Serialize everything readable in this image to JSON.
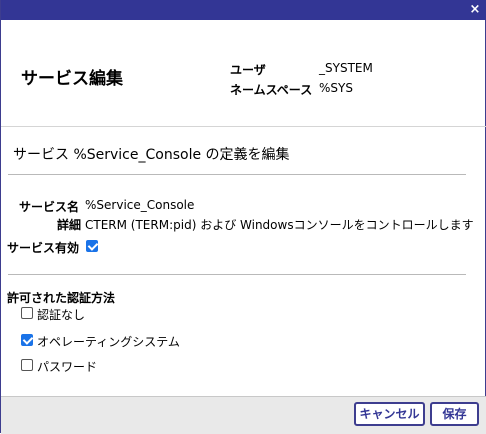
{
  "window": {
    "close_icon": "×"
  },
  "header": {
    "title": "サービス編集",
    "user_label": "ユーザ",
    "user_value": "_SYSTEM",
    "namespace_label": "ネームスペース",
    "namespace_value": "%SYS"
  },
  "main": {
    "subtitle": "サービス %Service_Console の定義を編集",
    "service_name_label": "サービス名",
    "service_name_value": "%Service_Console",
    "detail_label": "詳細",
    "detail_value": "CTERM (TERM:pid) および Windowsコンソールをコントロールします",
    "enabled_label": "サービス有効",
    "enabled_checked": true,
    "auth_title": "許可された認証方法",
    "auth_options": [
      {
        "label": "認証なし",
        "checked": false
      },
      {
        "label": "オペレーティングシステム",
        "checked": true
      },
      {
        "label": "パスワード",
        "checked": false
      }
    ]
  },
  "footer": {
    "cancel_label": "キャンセル",
    "save_label": "保存"
  },
  "colors": {
    "accent": "#333695",
    "checkbox": "#1a73e8"
  }
}
